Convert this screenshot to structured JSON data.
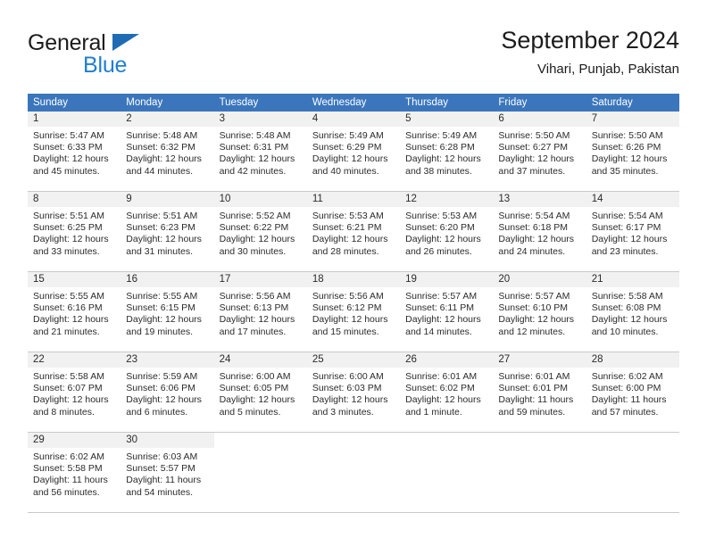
{
  "logo": {
    "word_one": "General",
    "word_two": "Blue",
    "triangle_icon": "blue-triangle-icon",
    "accent_color": "#1f7fd0"
  },
  "header": {
    "title": "September 2024",
    "subtitle": "Vihari, Punjab, Pakistan"
  },
  "theme": {
    "header_blue": "#3b76bc",
    "daynum_band": "#f1f1f1",
    "grid_line": "#c9c9c9",
    "text": "#2b2b2b"
  },
  "weekdays": [
    "Sunday",
    "Monday",
    "Tuesday",
    "Wednesday",
    "Thursday",
    "Friday",
    "Saturday"
  ],
  "weeks": [
    [
      {
        "day": "1",
        "sunrise": "Sunrise: 5:47 AM",
        "sunset": "Sunset: 6:33 PM",
        "daylight_1": "Daylight: 12 hours",
        "daylight_2": "and 45 minutes."
      },
      {
        "day": "2",
        "sunrise": "Sunrise: 5:48 AM",
        "sunset": "Sunset: 6:32 PM",
        "daylight_1": "Daylight: 12 hours",
        "daylight_2": "and 44 minutes."
      },
      {
        "day": "3",
        "sunrise": "Sunrise: 5:48 AM",
        "sunset": "Sunset: 6:31 PM",
        "daylight_1": "Daylight: 12 hours",
        "daylight_2": "and 42 minutes."
      },
      {
        "day": "4",
        "sunrise": "Sunrise: 5:49 AM",
        "sunset": "Sunset: 6:29 PM",
        "daylight_1": "Daylight: 12 hours",
        "daylight_2": "and 40 minutes."
      },
      {
        "day": "5",
        "sunrise": "Sunrise: 5:49 AM",
        "sunset": "Sunset: 6:28 PM",
        "daylight_1": "Daylight: 12 hours",
        "daylight_2": "and 38 minutes."
      },
      {
        "day": "6",
        "sunrise": "Sunrise: 5:50 AM",
        "sunset": "Sunset: 6:27 PM",
        "daylight_1": "Daylight: 12 hours",
        "daylight_2": "and 37 minutes."
      },
      {
        "day": "7",
        "sunrise": "Sunrise: 5:50 AM",
        "sunset": "Sunset: 6:26 PM",
        "daylight_1": "Daylight: 12 hours",
        "daylight_2": "and 35 minutes."
      }
    ],
    [
      {
        "day": "8",
        "sunrise": "Sunrise: 5:51 AM",
        "sunset": "Sunset: 6:25 PM",
        "daylight_1": "Daylight: 12 hours",
        "daylight_2": "and 33 minutes."
      },
      {
        "day": "9",
        "sunrise": "Sunrise: 5:51 AM",
        "sunset": "Sunset: 6:23 PM",
        "daylight_1": "Daylight: 12 hours",
        "daylight_2": "and 31 minutes."
      },
      {
        "day": "10",
        "sunrise": "Sunrise: 5:52 AM",
        "sunset": "Sunset: 6:22 PM",
        "daylight_1": "Daylight: 12 hours",
        "daylight_2": "and 30 minutes."
      },
      {
        "day": "11",
        "sunrise": "Sunrise: 5:53 AM",
        "sunset": "Sunset: 6:21 PM",
        "daylight_1": "Daylight: 12 hours",
        "daylight_2": "and 28 minutes."
      },
      {
        "day": "12",
        "sunrise": "Sunrise: 5:53 AM",
        "sunset": "Sunset: 6:20 PM",
        "daylight_1": "Daylight: 12 hours",
        "daylight_2": "and 26 minutes."
      },
      {
        "day": "13",
        "sunrise": "Sunrise: 5:54 AM",
        "sunset": "Sunset: 6:18 PM",
        "daylight_1": "Daylight: 12 hours",
        "daylight_2": "and 24 minutes."
      },
      {
        "day": "14",
        "sunrise": "Sunrise: 5:54 AM",
        "sunset": "Sunset: 6:17 PM",
        "daylight_1": "Daylight: 12 hours",
        "daylight_2": "and 23 minutes."
      }
    ],
    [
      {
        "day": "15",
        "sunrise": "Sunrise: 5:55 AM",
        "sunset": "Sunset: 6:16 PM",
        "daylight_1": "Daylight: 12 hours",
        "daylight_2": "and 21 minutes."
      },
      {
        "day": "16",
        "sunrise": "Sunrise: 5:55 AM",
        "sunset": "Sunset: 6:15 PM",
        "daylight_1": "Daylight: 12 hours",
        "daylight_2": "and 19 minutes."
      },
      {
        "day": "17",
        "sunrise": "Sunrise: 5:56 AM",
        "sunset": "Sunset: 6:13 PM",
        "daylight_1": "Daylight: 12 hours",
        "daylight_2": "and 17 minutes."
      },
      {
        "day": "18",
        "sunrise": "Sunrise: 5:56 AM",
        "sunset": "Sunset: 6:12 PM",
        "daylight_1": "Daylight: 12 hours",
        "daylight_2": "and 15 minutes."
      },
      {
        "day": "19",
        "sunrise": "Sunrise: 5:57 AM",
        "sunset": "Sunset: 6:11 PM",
        "daylight_1": "Daylight: 12 hours",
        "daylight_2": "and 14 minutes."
      },
      {
        "day": "20",
        "sunrise": "Sunrise: 5:57 AM",
        "sunset": "Sunset: 6:10 PM",
        "daylight_1": "Daylight: 12 hours",
        "daylight_2": "and 12 minutes."
      },
      {
        "day": "21",
        "sunrise": "Sunrise: 5:58 AM",
        "sunset": "Sunset: 6:08 PM",
        "daylight_1": "Daylight: 12 hours",
        "daylight_2": "and 10 minutes."
      }
    ],
    [
      {
        "day": "22",
        "sunrise": "Sunrise: 5:58 AM",
        "sunset": "Sunset: 6:07 PM",
        "daylight_1": "Daylight: 12 hours",
        "daylight_2": "and 8 minutes."
      },
      {
        "day": "23",
        "sunrise": "Sunrise: 5:59 AM",
        "sunset": "Sunset: 6:06 PM",
        "daylight_1": "Daylight: 12 hours",
        "daylight_2": "and 6 minutes."
      },
      {
        "day": "24",
        "sunrise": "Sunrise: 6:00 AM",
        "sunset": "Sunset: 6:05 PM",
        "daylight_1": "Daylight: 12 hours",
        "daylight_2": "and 5 minutes."
      },
      {
        "day": "25",
        "sunrise": "Sunrise: 6:00 AM",
        "sunset": "Sunset: 6:03 PM",
        "daylight_1": "Daylight: 12 hours",
        "daylight_2": "and 3 minutes."
      },
      {
        "day": "26",
        "sunrise": "Sunrise: 6:01 AM",
        "sunset": "Sunset: 6:02 PM",
        "daylight_1": "Daylight: 12 hours",
        "daylight_2": "and 1 minute."
      },
      {
        "day": "27",
        "sunrise": "Sunrise: 6:01 AM",
        "sunset": "Sunset: 6:01 PM",
        "daylight_1": "Daylight: 11 hours",
        "daylight_2": "and 59 minutes."
      },
      {
        "day": "28",
        "sunrise": "Sunrise: 6:02 AM",
        "sunset": "Sunset: 6:00 PM",
        "daylight_1": "Daylight: 11 hours",
        "daylight_2": "and 57 minutes."
      }
    ],
    [
      {
        "day": "29",
        "sunrise": "Sunrise: 6:02 AM",
        "sunset": "Sunset: 5:58 PM",
        "daylight_1": "Daylight: 11 hours",
        "daylight_2": "and 56 minutes."
      },
      {
        "day": "30",
        "sunrise": "Sunrise: 6:03 AM",
        "sunset": "Sunset: 5:57 PM",
        "daylight_1": "Daylight: 11 hours",
        "daylight_2": "and 54 minutes."
      },
      {
        "day": "",
        "sunrise": "",
        "sunset": "",
        "daylight_1": "",
        "daylight_2": ""
      },
      {
        "day": "",
        "sunrise": "",
        "sunset": "",
        "daylight_1": "",
        "daylight_2": ""
      },
      {
        "day": "",
        "sunrise": "",
        "sunset": "",
        "daylight_1": "",
        "daylight_2": ""
      },
      {
        "day": "",
        "sunrise": "",
        "sunset": "",
        "daylight_1": "",
        "daylight_2": ""
      },
      {
        "day": "",
        "sunrise": "",
        "sunset": "",
        "daylight_1": "",
        "daylight_2": ""
      }
    ]
  ]
}
